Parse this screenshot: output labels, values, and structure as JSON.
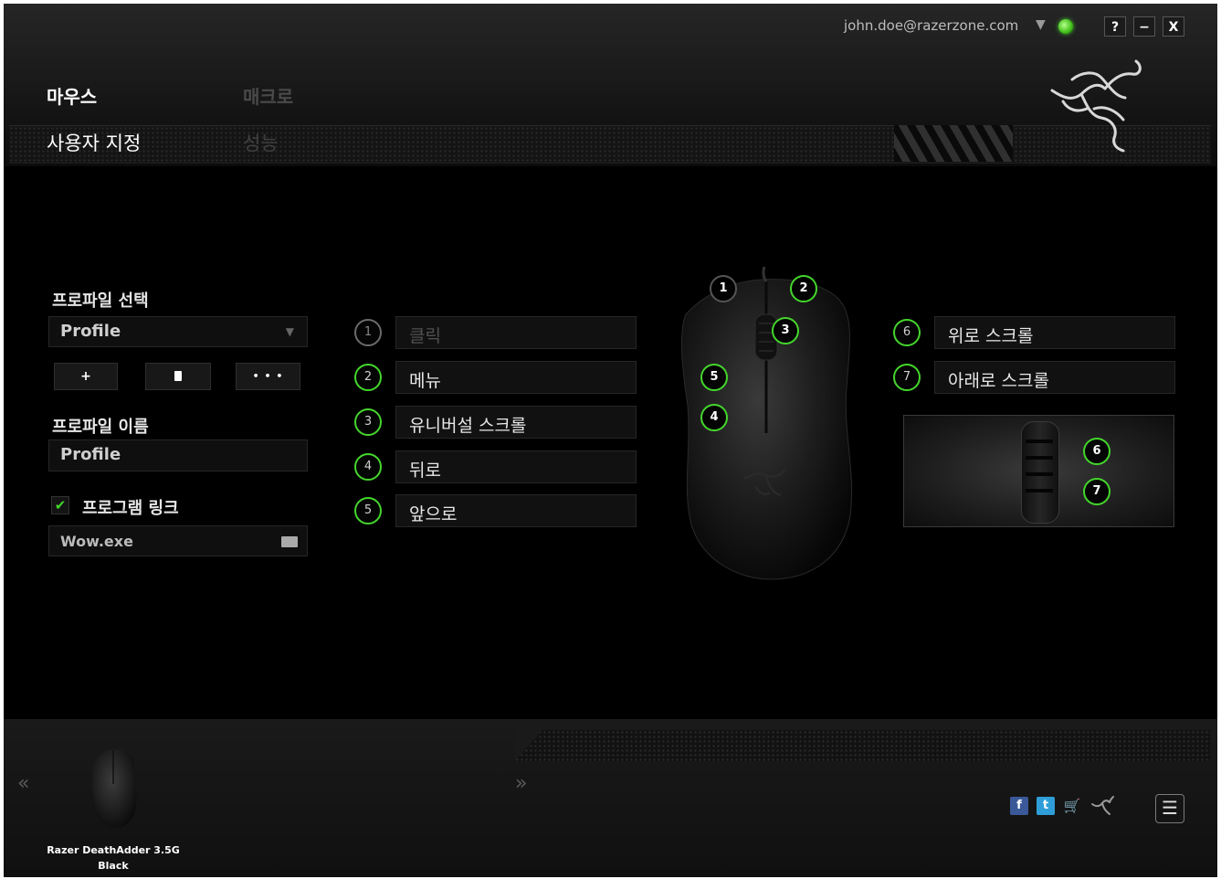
{
  "header": {
    "user_email": "john.doe@razerzone.com",
    "user_dropdown": "▼",
    "status_color": "#44d62c",
    "window_buttons": {
      "help": "?",
      "minimize": "−",
      "close": "X"
    },
    "tabs": [
      {
        "label": "마우스",
        "active": true
      },
      {
        "label": "매크로",
        "active": false
      }
    ],
    "subtabs": [
      {
        "label": "사용자 지정",
        "active": true
      },
      {
        "label": "성능",
        "active": false
      }
    ]
  },
  "profile": {
    "select_label": "프로파일 선택",
    "selected": "Profile",
    "dropdown_icon": "▼",
    "add_label": "+",
    "delete_label": "🗑",
    "more_label": "• • •",
    "name_label": "프로파일 이름",
    "name_value": "Profile",
    "link_label": "프로그램 링크",
    "link_checked": true,
    "checkmark": "✔",
    "program": "Wow.exe"
  },
  "assignments_left": [
    {
      "num": "1",
      "label": "클릭",
      "active": false
    },
    {
      "num": "2",
      "label": "메뉴",
      "active": true
    },
    {
      "num": "3",
      "label": "유니버설 스크롤",
      "active": true
    },
    {
      "num": "4",
      "label": "뒤로",
      "active": true
    },
    {
      "num": "5",
      "label": "앞으로",
      "active": true
    }
  ],
  "assignments_right": [
    {
      "num": "6",
      "label": "위로 스크롤"
    },
    {
      "num": "7",
      "label": "아래로 스크롤"
    }
  ],
  "mouse_markers": [
    "1",
    "2",
    "3",
    "5",
    "4"
  ],
  "zoom_markers": [
    "6",
    "7"
  ],
  "footer": {
    "prev": "«",
    "next": "»",
    "device_name_line1": "Razer DeathAdder 3.5G",
    "device_name_line2": "Black",
    "menu_icon": "☰",
    "social": {
      "facebook": "f",
      "twitter": "t",
      "cart": "🛒"
    }
  },
  "accent_color": "#44d62c"
}
